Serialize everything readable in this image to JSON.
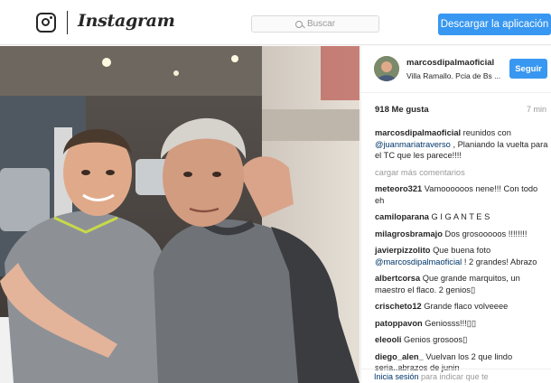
{
  "header": {
    "wordmark": "Instagram",
    "search_placeholder": "Buscar",
    "download_label": "Descargar la aplicación"
  },
  "post": {
    "username": "marcosdipalmaoficial",
    "location": "Villa Ramallo. Pcia de Bs ...",
    "follow_label": "Seguir",
    "likes": "918 Me gusta",
    "time": "7 min",
    "caption": {
      "user": "marcosdipalmaoficial",
      "pre": " reunidos con ",
      "mention": "@juanmariatraverso",
      "post": " , Planiando la vuelta para el TC que les parece!!!!"
    },
    "load_more": "cargar más comentarios",
    "comments": [
      {
        "user": "meteoro321",
        "text": " Vamoooooos nene!!! Con todo eh"
      },
      {
        "user": "camiloparana",
        "text": " G I G A N T E S"
      },
      {
        "user": "milagrosbramajo",
        "text": " Dos grosooooos !!!!!!!!"
      },
      {
        "user": "javierpizzolito",
        "text": " Que buena foto ",
        "mention": "@marcosdipalmaoficial",
        "after": " ! 2 grandes! Abrazo"
      },
      {
        "user": "albertcorsa",
        "text": " Que grande marquitos, un maestro el flaco. 2 genios▯"
      },
      {
        "user": "crischeto12",
        "text": " Grande flaco volveeee"
      },
      {
        "user": "patoppavon",
        "text": " Geniosss!!!▯▯"
      },
      {
        "user": "eleooli",
        "text": " Genios grosoos▯"
      },
      {
        "user": "diego_alen_",
        "text": " Vuelvan los 2 que lindo seria..abrazos de junin"
      }
    ],
    "login_link": "Inicia sesión",
    "login_rest": " para indicar que te"
  },
  "colors": {
    "accent": "#3897f0",
    "mention": "#003569",
    "muted": "#999999"
  }
}
